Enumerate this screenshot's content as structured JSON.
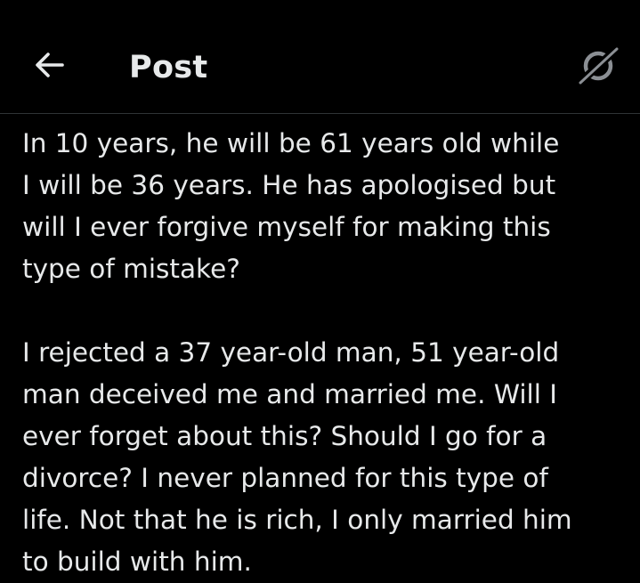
{
  "header": {
    "title": "Post",
    "back_icon": "arrow-left-icon",
    "grok_icon": "grok-icon"
  },
  "post": {
    "paragraphs": [
      "In 10 years, he will be 61 years old while\nI will be 36 years. He has apologised but\nwill I ever forgive myself for making this\ntype of mistake?",
      "I rejected a 37 year-old man, 51 year-old\nman deceived me and married me. Will I\never forget about this? Should I go for a\ndivorce? I never planned for this type of\nlife. Not that he is rich, I only married him\nto build with him."
    ]
  },
  "colors": {
    "background": "#000000",
    "text": "#e7e9ea",
    "divider": "#2f3336",
    "icon_muted": "#8b8f94"
  }
}
